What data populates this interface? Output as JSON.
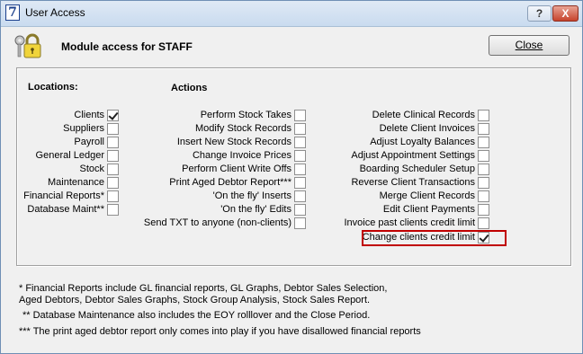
{
  "window": {
    "title": "User Access",
    "app_icon_glyph": "7",
    "help_glyph": "?",
    "close_glyph": "X"
  },
  "header": {
    "icon": "padlock-keys-icon",
    "module_title": "Module access for STAFF",
    "close_button": "Close"
  },
  "locations": {
    "heading": "Locations:",
    "items": [
      {
        "label": "Clients",
        "checked": true
      },
      {
        "label": "Suppliers",
        "checked": false
      },
      {
        "label": "Payroll",
        "checked": false
      },
      {
        "label": "General Ledger",
        "checked": false
      },
      {
        "label": "Stock",
        "checked": false
      },
      {
        "label": "Maintenance",
        "checked": false
      },
      {
        "label": "Financial Reports*",
        "checked": false
      },
      {
        "label": "Database Maint**",
        "checked": false
      }
    ]
  },
  "actions": {
    "heading": "Actions",
    "column1": [
      {
        "label": "Perform Stock Takes",
        "checked": false
      },
      {
        "label": "Modify Stock Records",
        "checked": false
      },
      {
        "label": "Insert New Stock Records",
        "checked": false
      },
      {
        "label": "Change Invoice Prices",
        "checked": false
      },
      {
        "label": "Perform Client Write Offs",
        "checked": false
      },
      {
        "label": "Print Aged Debtor Report***",
        "checked": false
      },
      {
        "label": "'On the fly' Inserts",
        "checked": false
      },
      {
        "label": "'On the fly' Edits",
        "checked": false
      },
      {
        "label": "Send TXT to anyone (non-clients)",
        "checked": false
      }
    ],
    "column2": [
      {
        "label": "Delete Clinical Records",
        "checked": false
      },
      {
        "label": "Delete Client Invoices",
        "checked": false
      },
      {
        "label": "Adjust Loyalty Balances",
        "checked": false
      },
      {
        "label": "Adjust Appointment Settings",
        "checked": false
      },
      {
        "label": "Boarding Scheduler Setup",
        "checked": false
      },
      {
        "label": "Reverse Client Transactions",
        "checked": false
      },
      {
        "label": "Merge Client Records",
        "checked": false
      },
      {
        "label": "Edit Client Payments",
        "checked": false
      },
      {
        "label": "Invoice past clients credit limit",
        "checked": false
      },
      {
        "label": "Change clients credit limit",
        "checked": true
      }
    ]
  },
  "highlight_color": "#c00000",
  "footnotes": {
    "note1_line1": "* Financial Reports include GL financial reports, GL Graphs, Debtor Sales Selection,",
    "note1_line2": "Aged Debtors, Debtor Sales Graphs, Stock Group Analysis, Stock Sales Report.",
    "note2": "** Database Maintenance also includes the EOY rolllover and the Close Period.",
    "note3": "*** The print aged debtor report only comes into play if you have disallowed financial reports"
  }
}
